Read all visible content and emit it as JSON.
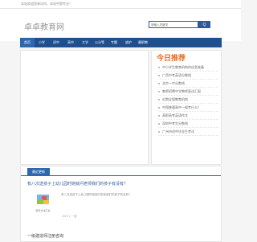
{
  "topbar": {
    "text": "本站欢迎您来访问，本站中国专业！"
  },
  "header": {
    "logo": "卓卓教育网",
    "search_placeholder": "请输入关键词",
    "search_button": "Q"
  },
  "nav": [
    "首页",
    "小学",
    "初中",
    "高中",
    "大学",
    "公分等",
    "专题",
    "放护",
    "最职教"
  ],
  "recommend": {
    "badge": "今日推荐",
    "items": [
      "中小学生教育机构的应急准备",
      "广西中考英语分数线",
      "北京一中分数线",
      "教师招聘中学教师面试汇报",
      "近期全国教育机构",
      "中国普通高中一般考什么？",
      "高职高考英语作文",
      "深圳中考生分数线",
      "广州市初中毕业生考试"
    ]
  },
  "latest": {
    "tab": "最近更新",
    "headline": "有八次送孩子上幼儿园时她就问老师我们的孩子有没有？",
    "excerpt": "有八次送孩子上幼儿园时她就问老师我们的孩子有没有？",
    "meta": "2020 1 一般",
    "thumb_text": "教育方法汇总",
    "second": "一级建造师注册咨询"
  }
}
